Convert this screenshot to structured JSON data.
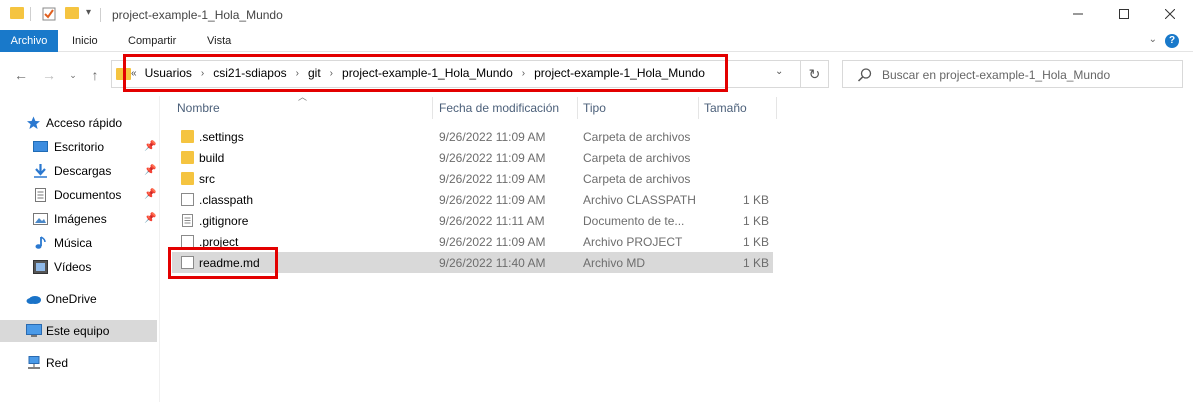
{
  "window": {
    "title": "project-example-1_Hola_Mundo"
  },
  "ribbon": {
    "tabs": [
      "Archivo",
      "Inicio",
      "Compartir",
      "Vista"
    ],
    "help_label": "?"
  },
  "address": {
    "overflow": "«",
    "breadcrumbs": [
      "Usuarios",
      "csi21-sdiapos",
      "git",
      "project-example-1_Hola_Mundo",
      "project-example-1_Hola_Mundo"
    ]
  },
  "search": {
    "placeholder": "Buscar en project-example-1_Hola_Mundo"
  },
  "sidebar": {
    "quick_access": "Acceso rápido",
    "items": [
      {
        "label": "Escritorio",
        "icon": "desktop-icon",
        "pinned": true
      },
      {
        "label": "Descargas",
        "icon": "download-icon",
        "pinned": true
      },
      {
        "label": "Documentos",
        "icon": "documents-icon",
        "pinned": true
      },
      {
        "label": "Imágenes",
        "icon": "pictures-icon",
        "pinned": true
      },
      {
        "label": "Música",
        "icon": "music-icon",
        "pinned": false
      },
      {
        "label": "Vídeos",
        "icon": "videos-icon",
        "pinned": false
      }
    ],
    "onedrive": "OneDrive",
    "this_pc": "Este equipo",
    "network": "Red"
  },
  "columns": {
    "name": "Nombre",
    "date": "Fecha de modificación",
    "type": "Tipo",
    "size": "Tamaño"
  },
  "files": [
    {
      "name": ".settings",
      "date": "9/26/2022 11:09 AM",
      "type": "Carpeta de archivos",
      "size": "",
      "kind": "folder"
    },
    {
      "name": "build",
      "date": "9/26/2022 11:09 AM",
      "type": "Carpeta de archivos",
      "size": "",
      "kind": "folder"
    },
    {
      "name": "src",
      "date": "9/26/2022 11:09 AM",
      "type": "Carpeta de archivos",
      "size": "",
      "kind": "folder"
    },
    {
      "name": ".classpath",
      "date": "9/26/2022 11:09 AM",
      "type": "Archivo CLASSPATH",
      "size": "1 KB",
      "kind": "file"
    },
    {
      "name": ".gitignore",
      "date": "9/26/2022 11:11 AM",
      "type": "Documento de te...",
      "size": "1 KB",
      "kind": "text"
    },
    {
      "name": ".project",
      "date": "9/26/2022 11:09 AM",
      "type": "Archivo PROJECT",
      "size": "1 KB",
      "kind": "file"
    },
    {
      "name": "readme.md",
      "date": "9/26/2022 11:40 AM",
      "type": "Archivo MD",
      "size": "1 KB",
      "kind": "file",
      "selected": true
    }
  ],
  "colors": {
    "accent": "#1979ca",
    "folder": "#f5c440",
    "highlight": "#e30000",
    "selection": "#d9d9d9"
  }
}
